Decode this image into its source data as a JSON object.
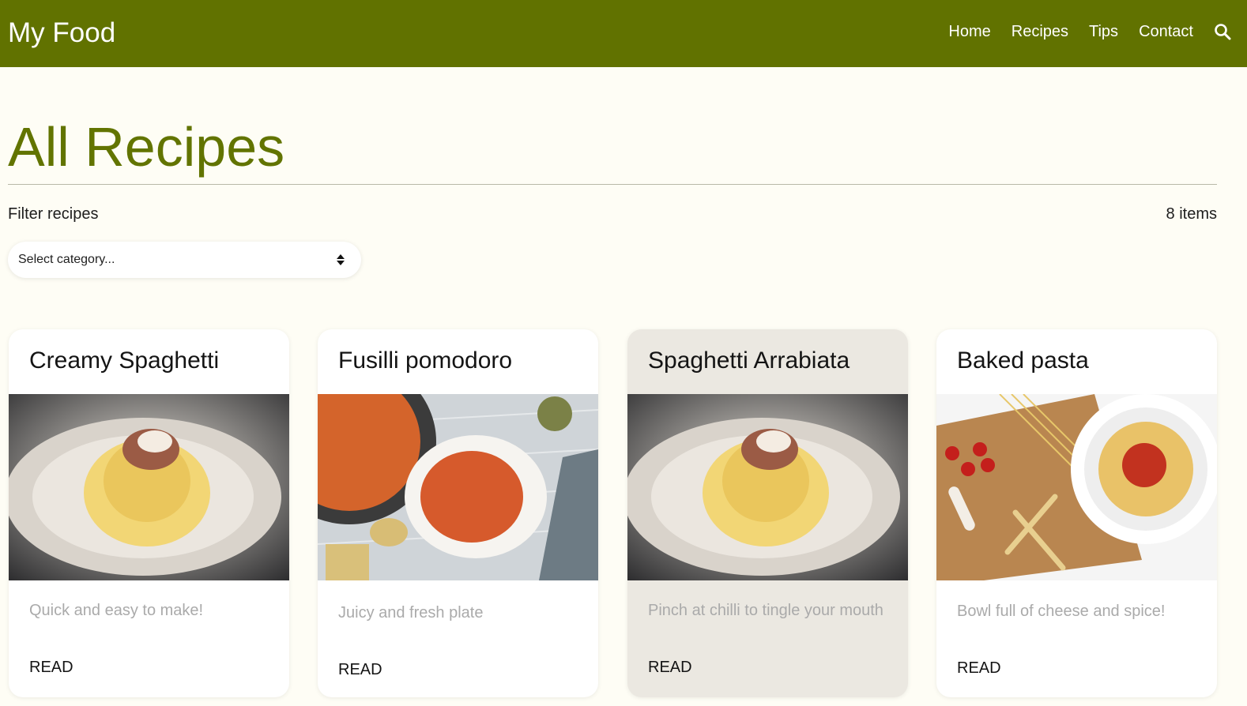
{
  "header": {
    "brand": "My Food",
    "nav": [
      "Home",
      "Recipes",
      "Tips",
      "Contact"
    ],
    "search_icon": "search-icon"
  },
  "main": {
    "title": "All Recipes",
    "filter_label": "Filter recipes",
    "items_count": "8 items",
    "category_select": {
      "value": "Select category..."
    }
  },
  "recipes": [
    {
      "title": "Creamy Spaghetti",
      "description": "Quick and easy to make!",
      "cta": "READ"
    },
    {
      "title": "Fusilli pomodoro",
      "description": "Juicy and fresh plate",
      "cta": "READ"
    },
    {
      "title": "Spaghetti Arrabiata",
      "description": "Pinch at chilli to tingle your mouth",
      "cta": "READ"
    },
    {
      "title": "Baked pasta",
      "description": "Bowl full of cheese and spice!",
      "cta": "READ"
    }
  ],
  "colors": {
    "brand_green": "#617200",
    "page_bg": "#fefdf5",
    "card_hover": "#ebe8e1"
  }
}
